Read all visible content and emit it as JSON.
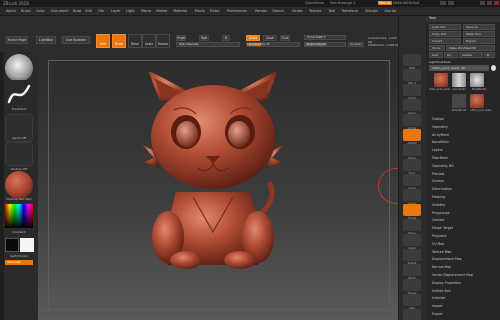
{
  "titlebar": {
    "app": "ZBrush 2018",
    "quicksave": "QuickSave",
    "see_through": "See-through 0",
    "menus": "Menus",
    "default_script": "DefaultZScript"
  },
  "menubar": {
    "items": [
      "Alpha",
      "Brush",
      "Color",
      "Document",
      "Draw",
      "Edit",
      "File",
      "Layer",
      "Light",
      "Macro",
      "Marker",
      "Material",
      "Movie",
      "Picker",
      "Preferences",
      "Render",
      "Stencil",
      "Stroke",
      "Texture",
      "Tool",
      "Transform",
      "Zplugin",
      "Zscript"
    ]
  },
  "toolbar": {
    "home_page": "Home Page",
    "lightbox": "LightBox",
    "live_boolean": "Live Boolean",
    "edit": "Edit",
    "draw": "Draw",
    "move": "Move",
    "scale": "Scale",
    "rotate": "Rotate",
    "mrgb": "Mrgb",
    "rgb": "Rgb",
    "m": "M",
    "rgb_intensity": "Rgb Intensity",
    "zadd": "Zadd",
    "zsub": "Zsub",
    "zcut": "Zcut",
    "z_intensity": "Z Intensity 25",
    "focal_shift": "Focal Shift 0",
    "draw_size": "Draw Size 64",
    "dynamic": "Dynamic",
    "active_points": "ActivePoints: 1,005 Mil",
    "total_points": "TotalPoints: 1,005 Mil"
  },
  "leftshelf": {
    "brush": "Standard",
    "stroke": "FreeHand",
    "alpha": "Alpha Off",
    "texture": "Texture Off",
    "material": "MatCap Red Wax",
    "gradient": "Gradient",
    "switch_color": "SwitchColor",
    "alternate": "Alternate",
    "colors": {
      "red_wax": "#a8452f",
      "orange": "#e9760e"
    }
  },
  "rightshelf": {
    "labels": [
      "BPR",
      "SPix 3",
      "Scroll",
      "Zoom",
      "Actual",
      "AAHalf",
      "Persp",
      "Floor",
      "Local",
      "L.Sym",
      "Frame",
      "Move",
      "Scale",
      "Rotate",
      "PolyF",
      "Transp",
      "Solo",
      "Xpose"
    ]
  },
  "tray": {
    "title": "Tool",
    "load_tool": "Load Tool",
    "save_as": "Save As",
    "copy_tool": "Copy Tool",
    "paste_tool": "Paste Tool",
    "import": "Import",
    "export": "Export",
    "clone": "Clone",
    "make_polymesh": "Make PolyMesh3D",
    "goz": "GoZ",
    "all": "All",
    "visible": "Visible",
    "r": "R",
    "lightbox_tools": "Lightbox▸Tools",
    "tool_name": "kitten_print_ready: 48",
    "thumb_labels": [
      "kitten_print_ready",
      "Cylinder3D",
      "PolyMesh3D",
      "SimpleBrush",
      "kitten_print_ready"
    ],
    "menu": [
      "Subtool",
      "Geometry",
      "ArrayMesh",
      "NanoMesh",
      "Layers",
      "FiberMesh",
      "Geometry HD",
      "Preview",
      "Surface",
      "Deformation",
      "Masking",
      "Visibility",
      "Polygroups",
      "Contact",
      "Morph Target",
      "Polypaint",
      "UV Map",
      "Texture Map",
      "Displacement Map",
      "Normal Map",
      "Vector Displacement Map",
      "Display Properties",
      "Unified Skin",
      "Initialize",
      "Import",
      "Export"
    ]
  }
}
